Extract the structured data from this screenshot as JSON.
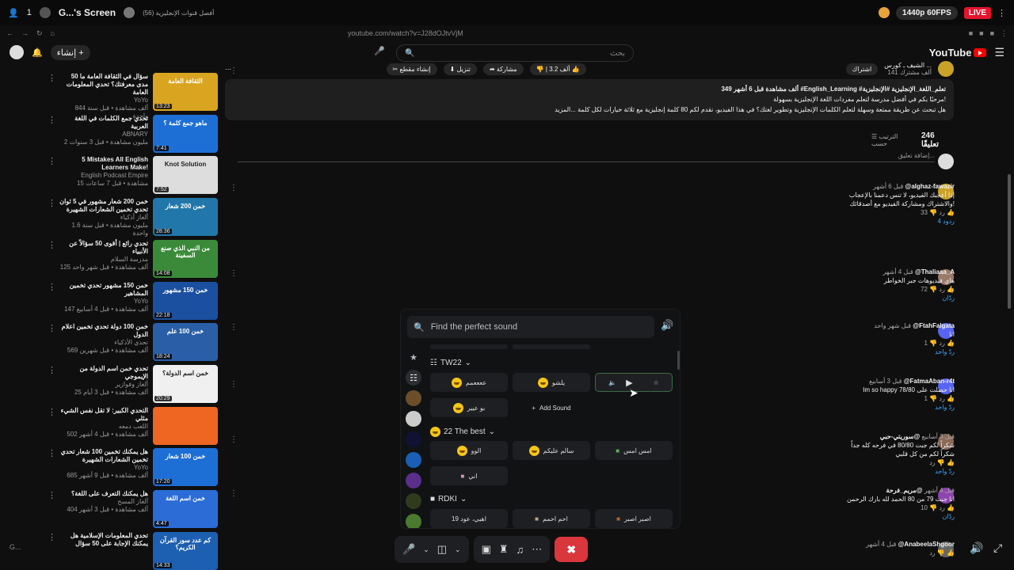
{
  "stream": {
    "count": "1",
    "title": "G...'s Screen",
    "tab": "أفضل قنوات الإنجليزية (56)",
    "quality": "1440p 60FPS",
    "live": "LIVE"
  },
  "address": {
    "url": "youtube.com/watch?v=J28dOJtvVjM"
  },
  "header": {
    "create": "إنشاء",
    "brand": "YouTube",
    "search_placeholder": "بحث"
  },
  "channel": {
    "name": "الشيف ـ كورس ...",
    "subs": "141 ألف مشترك",
    "join": "اشتراك"
  },
  "actions": {
    "like": "3.2 ألف",
    "share": "مشاركة",
    "download": "تنزيل",
    "clip": "إنشاء مقطع"
  },
  "description": {
    "line1": "349 ألف مشاهدة قبل 6 أشهر  #English_Learning #تعلم_اللغة_الإنجليزية #الإنجليزية",
    "line2": "مرحبًا بكم في أفضل مدرسة لتعلم مفردات اللغة الإنجليزية بسهولة!",
    "line3": "هل تبحث عن طريقة ممتعة وسهلة لتعلم الكلمات الإنجليزية وتطوير لغتك؟ في هذا الفيديو، نقدم لكم 80 كلمة إنجليزية مع ثلاثة خيارات لكل كلمة ...المزيد"
  },
  "comments_header": {
    "count": "246 تعليقًا",
    "sort": "الترتيب حسب",
    "add": "إضافة تعليق..."
  },
  "comments": [
    {
      "name": "@alghaz-fawazir",
      "time": "قبل 6 أشهر",
      "text": "إذا أعجبك الفيديو، لا تنس دعمنا بالإعجاب والاشتراك ومشاركة الفيديو مع أصدقائك!",
      "likes": "33",
      "replies": "4 ردود"
    },
    {
      "name": "@Thaliaaa_A",
      "time": "قبل 4 أشهر",
      "text": "هاي فيديوهات جبر الخواطر",
      "likes": "72",
      "replies": "ردّان"
    },
    {
      "name": "@FtahFalgata",
      "time": "قبل شهر واحد",
      "text": "انا",
      "likes": "1",
      "replies": "ردّ واحد"
    },
    {
      "name": "@FatmaAban-r4t",
      "time": "قبل 3 أسابيع",
      "text": "Im so happy 78/80 انا حصلت على",
      "likes": "1",
      "replies": "ردّ واحد"
    },
    {
      "name": "@سوريتي-حبي",
      "time": "قبل 3 أسابيع",
      "text": "شكراً لكم جبت 80/80 في فرحه كله جداً شكراً لكم من كل قلبي",
      "likes": "",
      "replies": "ردّ واحد"
    },
    {
      "name": "@مريم_فرحة",
      "time": "قبل 4 أشهر",
      "text": "انا جبت 79 من 80 الحمد لله بارك الرحمن",
      "likes": "10",
      "replies": "ردّان"
    },
    {
      "name": "@AnabeelaShgoor",
      "time": "قبل 4 أشهر",
      "text": "",
      "likes": "",
      "replies": ""
    }
  ],
  "videos": [
    {
      "title": "50 سؤال في الثقافة العامة ما مدى معرفتك؟ تحدي المعلومات العامة",
      "channel": "YoYo",
      "meta": "844 ألف مشاهدة • قبل سنة واحدة",
      "dur": "13:23",
      "label": "الثقافة العامة"
    },
    {
      "title": "تحدي جمع الكلمات في اللغة العربية",
      "channel": "ABNARY",
      "meta": "2 مليون مشاهدة • قبل 3 سنوات",
      "dur": "7:41",
      "label": "ماهو جمع كلمة ؟"
    },
    {
      "title": "5 Mistakes All English Learners Make!",
      "channel": "English Podcast Empire",
      "meta": "15 مشاهدة • قبل 7 ساعات",
      "dur": "7:52",
      "label": "Knot Solution"
    },
    {
      "title": "خمن 200 شعار مشهور في 5 ثوان تحدي تخمين الشعارات الشهيرة",
      "channel": "ألغاز أذكياء",
      "meta": "1.6 مليون مشاهدة • قبل سنة واحدة",
      "dur": "28:36",
      "label": "خمن 200 شعار"
    },
    {
      "title": "تحدي رائع | أقوى 50 سؤالاً عن الأنبياء",
      "channel": "مدرسة السلام",
      "meta": "125 ألف مشاهدة • قبل شهر واحد",
      "dur": "14:08",
      "label": "من النبي الذي صنع السفينة"
    },
    {
      "title": "خمن 150 مشهور تحدي تخمين المشاهير",
      "channel": "YoYo",
      "meta": "147 ألف مشاهدة • قبل 4 أسابيع",
      "dur": "22:18",
      "label": "خمن 150 مشهور"
    },
    {
      "title": "خمن 100 دولة تحدي تخمين اعلام الدول",
      "channel": "تحدي الأذكياء",
      "meta": "569 ألف مشاهدة • قبل شهرين",
      "dur": "18:24",
      "label": "خمن 100 علم"
    },
    {
      "title": "تحدي خمن اسم الدولة من الإيموجي",
      "channel": "ألغاز وفوازير",
      "meta": "25 ألف مشاهدة • قبل 3 أيام",
      "dur": "20:29",
      "label": "خمن اسم الدولة؟"
    },
    {
      "title": "التحدي الكبير: لا تقل نفس الشيء مثلي",
      "channel": "اللعب دمعه",
      "meta": "502 ألف مشاهدة • قبل 4 أشهر",
      "dur": "",
      "label": ""
    },
    {
      "title": "هل يمكنك تخمين 100 شعار تحدي تخمين الشعارات الشهيرة",
      "channel": "YoYo",
      "meta": "685 ألف مشاهدة • قبل 9 أشهر",
      "dur": "17:20",
      "label": "خمن 100 شعار"
    },
    {
      "title": "هل يمكنك التعرف على اللغة؟",
      "channel": "ألغاز المسح",
      "meta": "404 ألف مشاهدة • قبل 3 أشهر",
      "dur": "4:47",
      "label": "خمن اسم اللغة"
    },
    {
      "title": "تحدي المعلومات الإسلامية هل يمكنك الإجابة على 50 سؤال",
      "channel": "",
      "meta": "",
      "dur": "14:33",
      "label": "كم عدد سور القرآن الكريم؟"
    }
  ],
  "sound_panel": {
    "search_placeholder": "Find the perfect sound",
    "sections": [
      {
        "name": "TW22",
        "sounds": [
          "ععععمم",
          "يلشو",
          "",
          "بو عيير"
        ],
        "add": "Add Sound"
      },
      {
        "name": "22 The best",
        "sounds": [
          "الوو",
          "سالم عليكم",
          "امس امس",
          "اني"
        ]
      },
      {
        "name": "RDKI",
        "sounds": [
          "اهيي، عود 19",
          "احم احمم",
          "اصبر اصبر"
        ]
      }
    ]
  },
  "footer_left": "G..."
}
